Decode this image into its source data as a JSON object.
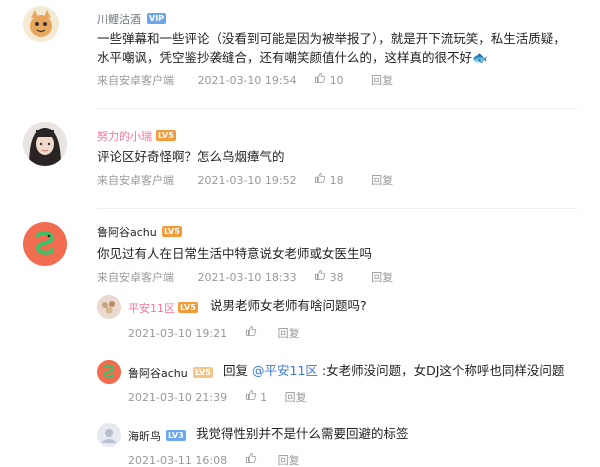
{
  "comments": [
    {
      "user": "川鲤沽酒",
      "badge": "VIP",
      "text": "一些弹幕和一些评论（没看到可能是因为被举报了），就是开下流玩笑，私生活质疑，水平嘲讽，凭空鉴抄袭缝合，还有嘲笑颜值什么的，这样真的很不好🐟",
      "source": "来自安卓客户端",
      "time": "2021-03-10 19:54",
      "likes": "10",
      "reply_label": "回复"
    },
    {
      "user": "努力的小瑞",
      "badge": "LV5",
      "text": "评论区好奇怪啊？怎么乌烟瘴气的",
      "source": "来自安卓客户端",
      "time": "2021-03-10 19:52",
      "likes": "18",
      "reply_label": "回复"
    },
    {
      "user": "鲁阿谷achu",
      "badge": "LV5",
      "text": "你见过有人在日常生活中特意说女老师或女医生吗",
      "source": "来自安卓客户端",
      "time": "2021-03-10 18:33",
      "likes": "38",
      "reply_label": "回复",
      "replies": [
        {
          "user": "平安11区",
          "badge": "LV5",
          "text": "说男老师女老师有啥问题吗?",
          "time": "2021-03-10 19:21",
          "likes": "",
          "reply_label": "回复"
        },
        {
          "user": "鲁阿谷achu",
          "badge": "LV5",
          "prefix": "回复",
          "mention": "@平安11区",
          "text": ":女老师没问题，女DJ这个称呼也同样没问题",
          "time": "2021-03-10 21:39",
          "likes": "1",
          "reply_label": "回复"
        },
        {
          "user": "海昕鸟",
          "badge": "LV3",
          "text": "我觉得性别并不是什么需要回避的标签",
          "time": "2021-03-11 16:08",
          "likes": "",
          "reply_label": "回复"
        }
      ]
    }
  ],
  "colors": {
    "vip_name": "#6d757a",
    "pink_name": "#fb7299",
    "badge_blue": "#6aa7f0",
    "badge_orange": "#f39a3a"
  },
  "icons": {
    "like": "thumb-up-icon"
  }
}
